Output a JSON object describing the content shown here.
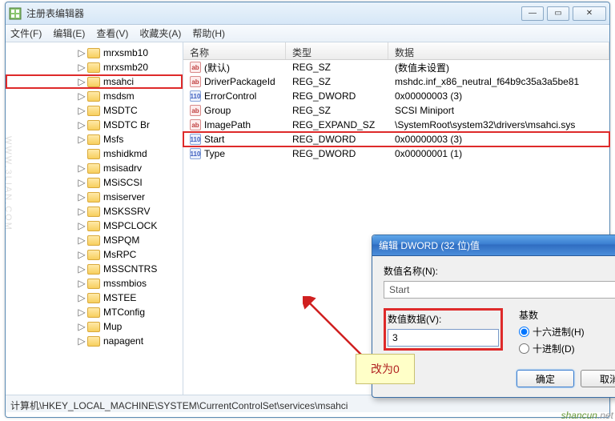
{
  "window": {
    "title": "注册表编辑器",
    "controls": {
      "minimize": "—",
      "maximize": "▭",
      "close": "✕"
    }
  },
  "menu": {
    "file": "文件(F)",
    "edit": "编辑(E)",
    "view": "查看(V)",
    "favorites": "收藏夹(A)",
    "help": "帮助(H)"
  },
  "tree": {
    "items": [
      {
        "name": "mrxsmb10",
        "expander": "▷"
      },
      {
        "name": "mrxsmb20",
        "expander": "▷"
      },
      {
        "name": "msahci",
        "expander": "▷",
        "highlight": true
      },
      {
        "name": "msdsm",
        "expander": "▷"
      },
      {
        "name": "MSDTC",
        "expander": "▷"
      },
      {
        "name": "MSDTC Br",
        "expander": "▷"
      },
      {
        "name": "Msfs",
        "expander": "▷"
      },
      {
        "name": "mshidkmd",
        "expander": ""
      },
      {
        "name": "msisadrv",
        "expander": "▷"
      },
      {
        "name": "MSiSCSI",
        "expander": "▷"
      },
      {
        "name": "msiserver",
        "expander": "▷"
      },
      {
        "name": "MSKSSRV",
        "expander": "▷"
      },
      {
        "name": "MSPCLOCK",
        "expander": "▷"
      },
      {
        "name": "MSPQM",
        "expander": "▷"
      },
      {
        "name": "MsRPC",
        "expander": "▷"
      },
      {
        "name": "MSSCNTRS",
        "expander": "▷"
      },
      {
        "name": "mssmbios",
        "expander": "▷"
      },
      {
        "name": "MSTEE",
        "expander": "▷"
      },
      {
        "name": "MTConfig",
        "expander": "▷"
      },
      {
        "name": "Mup",
        "expander": "▷"
      },
      {
        "name": "napagent",
        "expander": "▷"
      }
    ]
  },
  "list": {
    "headers": {
      "name": "名称",
      "type": "类型",
      "data": "数据"
    },
    "rows": [
      {
        "icon": "sz",
        "name": "(默认)",
        "type": "REG_SZ",
        "data": "(数值未设置)"
      },
      {
        "icon": "sz",
        "name": "DriverPackageId",
        "type": "REG_SZ",
        "data": "mshdc.inf_x86_neutral_f64b9c35a3a5be81"
      },
      {
        "icon": "dw",
        "name": "ErrorControl",
        "type": "REG_DWORD",
        "data": "0x00000003 (3)"
      },
      {
        "icon": "sz",
        "name": "Group",
        "type": "REG_SZ",
        "data": "SCSI Miniport"
      },
      {
        "icon": "sz",
        "name": "ImagePath",
        "type": "REG_EXPAND_SZ",
        "data": "\\SystemRoot\\system32\\drivers\\msahci.sys"
      },
      {
        "icon": "dw",
        "name": "Start",
        "type": "REG_DWORD",
        "data": "0x00000003 (3)",
        "highlight": true
      },
      {
        "icon": "dw",
        "name": "Type",
        "type": "REG_DWORD",
        "data": "0x00000001 (1)"
      }
    ]
  },
  "dialog": {
    "title": "编辑 DWORD (32 位)值",
    "name_label": "数值名称(N):",
    "name_value": "Start",
    "data_label": "数值数据(V):",
    "data_value": "3",
    "radix_label": "基数",
    "radix_hex": "十六进制(H)",
    "radix_dec": "十进制(D)",
    "ok": "确定",
    "cancel": "取消"
  },
  "statusbar": "计算机\\HKEY_LOCAL_MACHINE\\SYSTEM\\CurrentControlSet\\services\\msahci",
  "annotation": "改为0",
  "watermark": "shancun",
  "wm_vert": "WWW.3LIAN.COM"
}
